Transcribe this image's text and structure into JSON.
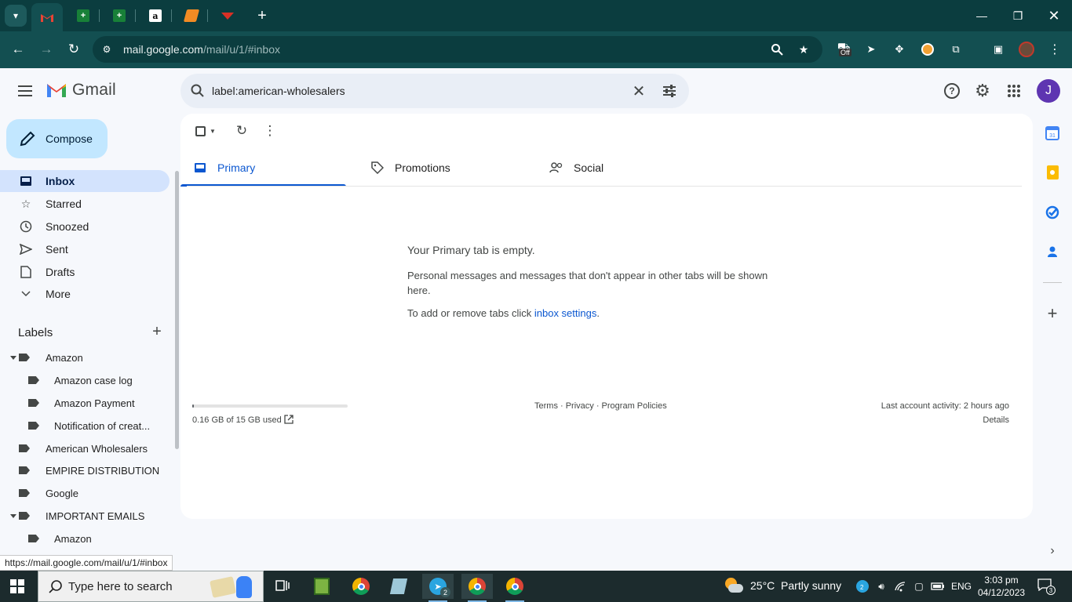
{
  "browser": {
    "url_host": "mail.google.com",
    "url_path": "/mail/u/1/#inbox",
    "extension_off_badge": "Off",
    "window_controls": [
      "minimize",
      "restore",
      "close"
    ]
  },
  "gmail": {
    "logo_text": "Gmail",
    "search": {
      "value": "label:american-wholesalers"
    },
    "avatar_initial": "J",
    "compose_label": "Compose",
    "nav": [
      {
        "label": "Inbox",
        "icon": "inbox-icon",
        "active": true
      },
      {
        "label": "Starred",
        "icon": "star-icon"
      },
      {
        "label": "Snoozed",
        "icon": "clock-icon"
      },
      {
        "label": "Sent",
        "icon": "send-icon"
      },
      {
        "label": "Drafts",
        "icon": "draft-icon"
      },
      {
        "label": "More",
        "icon": "chevron-down-icon"
      }
    ],
    "labels_heading": "Labels",
    "labels": [
      {
        "label": "Amazon",
        "expanded": true,
        "level": 0
      },
      {
        "label": "Amazon case log",
        "level": 1
      },
      {
        "label": "Amazon Payment",
        "level": 1
      },
      {
        "label": "Notification of creat...",
        "level": 1
      },
      {
        "label": "American Wholesalers",
        "level": 0
      },
      {
        "label": "EMPIRE DISTRIBUTION",
        "level": 0
      },
      {
        "label": "Google",
        "level": 0
      },
      {
        "label": "IMPORTANT EMAILS",
        "expanded": true,
        "level": 0
      },
      {
        "label": "Amazon",
        "level": 1
      }
    ],
    "tabs": [
      {
        "label": "Primary",
        "icon": "inbox-tab-icon",
        "active": true
      },
      {
        "label": "Promotions",
        "icon": "tag-icon"
      },
      {
        "label": "Social",
        "icon": "people-icon"
      }
    ],
    "empty": {
      "title": "Your Primary tab is empty.",
      "message": "Personal messages and messages that don't appear in other tabs will be shown here.",
      "settings_prefix": "To add or remove tabs click ",
      "settings_link": "inbox settings",
      "settings_suffix": "."
    },
    "footer": {
      "storage_text": "0.16 GB of 15 GB used",
      "storage_fraction": 0.0107,
      "links": "Terms · Privacy · Program Policies",
      "activity": "Last account activity: 2 hours ago",
      "details": "Details"
    },
    "side_apps": [
      "calendar-icon",
      "keep-icon",
      "tasks-icon",
      "contacts-icon"
    ]
  },
  "status_bar_url": "https://mail.google.com/mail/u/1/#inbox",
  "taskbar": {
    "search_placeholder": "Type here to search",
    "telegram_badge": "2",
    "weather": "25°C  Partly sunny",
    "language": "ENG",
    "time": "3:03 pm",
    "date": "04/12/2023",
    "notification_count": "3",
    "tray_badge": "2"
  },
  "colors": {
    "browser_frame": "#0b3d3f",
    "toolbar": "#134f51",
    "gmail_bg": "#f6f8fc",
    "compose_bg": "#c2e7ff",
    "active_nav": "#d3e3fd",
    "accent_blue": "#0b57d0",
    "avatar": "#5e35b1"
  }
}
